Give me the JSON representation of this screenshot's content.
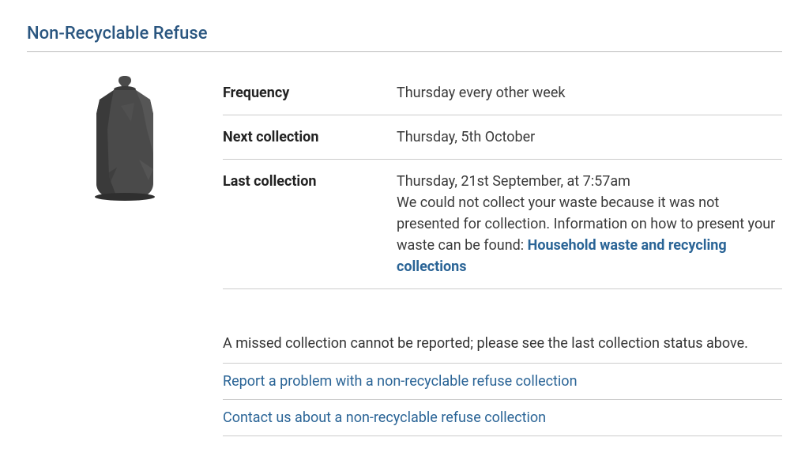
{
  "title": "Non-Recyclable Refuse",
  "icon": "refuse-bag-icon",
  "details": {
    "frequency": {
      "label": "Frequency",
      "value": "Thursday every other week"
    },
    "next": {
      "label": "Next collection",
      "value": "Thursday, 5th October"
    },
    "last": {
      "label": "Last collection",
      "date": "Thursday, 21st September, at 7:57am",
      "message_prefix": "We could not collect your waste because it was not presented for collection. Information on how to present your waste can be found: ",
      "link_label": "Household waste and recycling collections"
    }
  },
  "notice": "A missed collection cannot be reported; please see the last collection status above.",
  "links": {
    "report": "Report a problem with a non-recyclable refuse collection",
    "contact": "Contact us about a non-recyclable refuse collection"
  }
}
